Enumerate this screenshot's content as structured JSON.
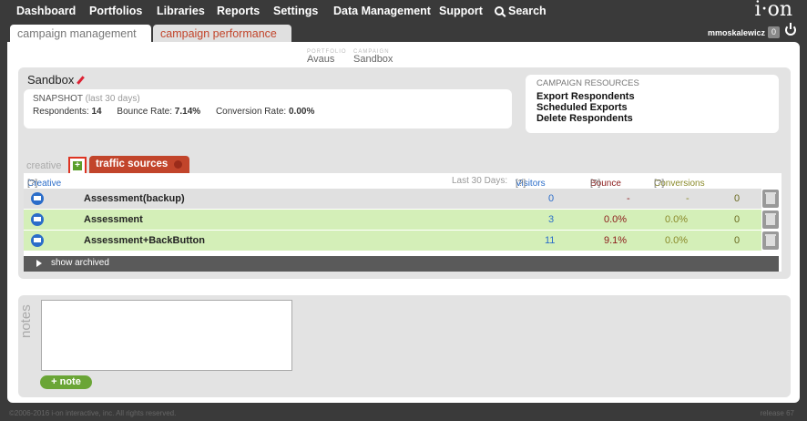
{
  "nav": {
    "items": [
      "Dashboard",
      "Portfolios",
      "Libraries",
      "Reports",
      "Settings",
      "Data Management",
      "Support",
      "Search"
    ],
    "logo": "i·on"
  },
  "tabs": {
    "campaign_management": "campaign management",
    "campaign_performance": "campaign performance"
  },
  "user": {
    "name": "mmoskalewicz",
    "badge": "0"
  },
  "breadcrumb": {
    "portfolio_label": "PORTFOLIO",
    "portfolio": "Avaus",
    "campaign_label": "CAMPAIGN",
    "campaign": "Sandbox"
  },
  "campaign": {
    "title": "Sandbox",
    "snapshot_title": "SNAPSHOT",
    "snapshot_sub": "(last 30 days)",
    "respondents_label": "Respondents:",
    "respondents": "14",
    "bounce_label": "Bounce Rate:",
    "bounce": "7.14%",
    "conversion_label": "Conversion Rate:",
    "conversion": "0.00%"
  },
  "resources": {
    "title": "CAMPAIGN RESOURCES",
    "links": [
      "Export Respondents",
      "Scheduled Exports",
      "Delete Respondents"
    ]
  },
  "creative_tabs": {
    "creative": "creative",
    "plus": "+",
    "traffic": "traffic sources"
  },
  "table": {
    "creative_label": "Creative",
    "help": "[?]",
    "last30": "Last 30 Days:",
    "visitors": "Visitors",
    "bounce": "Bounce",
    "conversions": "Conversions",
    "rows": [
      {
        "name": "Assessment(backup)",
        "visitors": "0",
        "bounce": "-",
        "conv": "-",
        "num": "0",
        "bg": "#e0e0e0"
      },
      {
        "name": "Assessment",
        "visitors": "3",
        "bounce": "0.0%",
        "conv": "0.0%",
        "num": "0",
        "bg": "#d4efb8"
      },
      {
        "name": "Assessment+BackButton",
        "visitors": "11",
        "bounce": "9.1%",
        "conv": "0.0%",
        "num": "0",
        "bg": "#d4efb8"
      }
    ],
    "show_archived": "show archived"
  },
  "notes": {
    "label": "notes",
    "add_button": "+ note"
  },
  "footer": {
    "copyright": "©2006-2016 i-on interactive, inc. All rights reserved.",
    "release": "release 67"
  },
  "colors": {
    "accent": "#c2452b",
    "green_row": "#d4efb8",
    "grey_row": "#e0e0e0",
    "link_blue": "#2b6dc9"
  }
}
